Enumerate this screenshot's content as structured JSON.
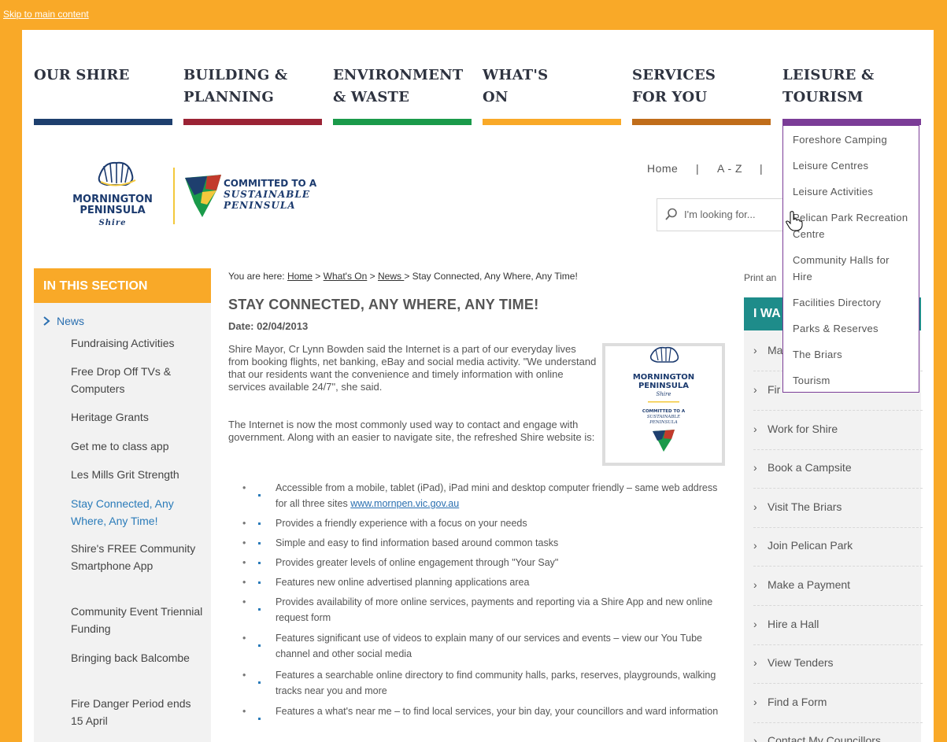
{
  "skip_link": "Skip to main content",
  "nav": [
    {
      "label": "OUR SHIRE",
      "color": "#1e3f6e"
    },
    {
      "label": "BUILDING &\nPLANNING",
      "color": "#9b2335"
    },
    {
      "label": "ENVIRONMENT\n& WASTE",
      "color": "#1a9a4a"
    },
    {
      "label": "WHAT'S\nON",
      "color": "#f9a928"
    },
    {
      "label": "SERVICES\nFOR YOU",
      "color": "#c06d1a"
    },
    {
      "label": "LEISURE &\nTOURISM",
      "color": "#7b3c97"
    }
  ],
  "logo": {
    "line1": "MORNINGTON",
    "line2": "PENINSULA",
    "line3": "Shire",
    "committed1": "COMMITTED TO A",
    "committed2": "SUSTAINABLE",
    "committed3": "PENINSULA"
  },
  "utility": {
    "home": "Home",
    "sep": "|",
    "az": "A - Z"
  },
  "search": {
    "placeholder": "I'm looking for..."
  },
  "section_heading": "IN THIS SECTION",
  "left_nav": {
    "parent": "News",
    "items": [
      "Fundraising Activities",
      "Free Drop Off TVs & Computers",
      "Heritage Grants",
      "Get me to class app",
      "Les Mills Grit Strength",
      "Stay Connected, Any Where, Any Time!",
      "Shire's FREE Community Smartphone App",
      "Community Event Triennial Funding",
      "Bringing back Balcombe",
      "Fire Danger Period ends 15 April"
    ]
  },
  "breadcrumb": {
    "prefix": "You are here: ",
    "home": "Home",
    "sep": " > ",
    "whats_on": "What's On",
    "news": "News ",
    "current": "Stay Connected, Any Where, Any Time!"
  },
  "article": {
    "title": "STAY CONNECTED, ANY WHERE, ANY TIME!",
    "date": "Date: 02/04/2013",
    "p1": "Shire Mayor, Cr Lynn Bowden said the Internet is a part of our everyday lives from booking flights, net banking, eBay and social media activity. \"We understand that our residents want the convenience and timely information with online services available 24/7\", she said.",
    "p2": "The Internet is now the most commonly used way to contact and engage with government.  Along with an easier to navigate site, the refreshed Shire website is:",
    "bullets": [
      "Accessible from a mobile, tablet (iPad), iPad mini and desktop computer friendly – same web address for all three sites ",
      "Provides a friendly experience with a focus on your needs",
      "Simple and easy to find information based around common tasks",
      "Provides greater levels of online engagement through \"Your Say\"",
      "Features new online advertised planning applications area",
      "Provides availability of more online services, payments and reporting via a Shire App and new online request form",
      "Features significant use of videos to explain many of our services and events – view our You Tube channel and other social media",
      "Features a searchable online directory to find community halls, parks, reserves, playgrounds, walking tracks near you and more",
      "Features a what's near me  – to find local services, your bin day, your councillors and ward information"
    ],
    "link": "www.mornpen.vic.gov.au"
  },
  "right": {
    "print": "Print an",
    "iwant": "I WA",
    "items": [
      "Ma",
      "Fir",
      "Work for Shire",
      "Book a Campsite",
      "Visit The Briars",
      "Join Pelican Park",
      "Make a Payment",
      "Hire a Hall",
      "View Tenders",
      "Find a Form",
      "Contact My Councillors"
    ]
  },
  "dropdown": [
    "Foreshore Camping",
    "Leisure Centres",
    "Leisure Activities",
    "Pelican Park Recreation Centre",
    "Community Halls for Hire",
    "Facilities Directory",
    "Parks & Reserves",
    "The Briars",
    "Tourism"
  ]
}
